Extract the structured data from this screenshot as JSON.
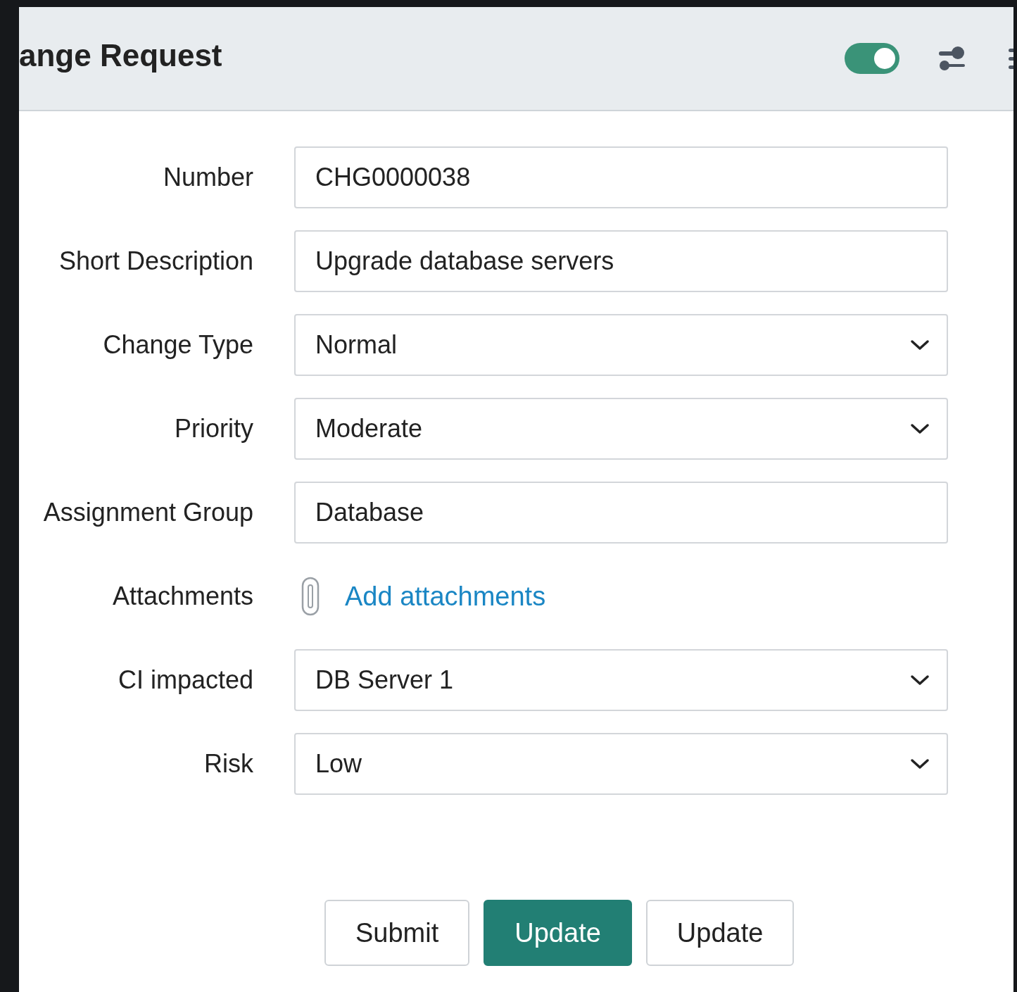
{
  "header": {
    "title": "ange Request",
    "toggle": {
      "on": true
    }
  },
  "fields": [
    {
      "kind": "text",
      "label": "Number",
      "value": "CHG0000038"
    },
    {
      "kind": "text",
      "label": "Short Description",
      "value": "Upgrade database servers"
    },
    {
      "kind": "select",
      "label": "Change Type",
      "value": "Normal"
    },
    {
      "kind": "select",
      "label": "Priority",
      "value": "Moderate"
    },
    {
      "kind": "text",
      "label": "Assignment Group",
      "value": "Database"
    },
    {
      "kind": "attachment",
      "label": "Attachments",
      "link": "Add attachments"
    },
    {
      "kind": "select",
      "label": "CI impacted",
      "value": "DB Server 1"
    },
    {
      "kind": "select",
      "label": "Risk",
      "value": "Low"
    }
  ],
  "buttons": [
    {
      "label": "Submit",
      "kind": "default"
    },
    {
      "label": "Update",
      "kind": "primary"
    },
    {
      "label": "Update",
      "kind": "default"
    }
  ]
}
